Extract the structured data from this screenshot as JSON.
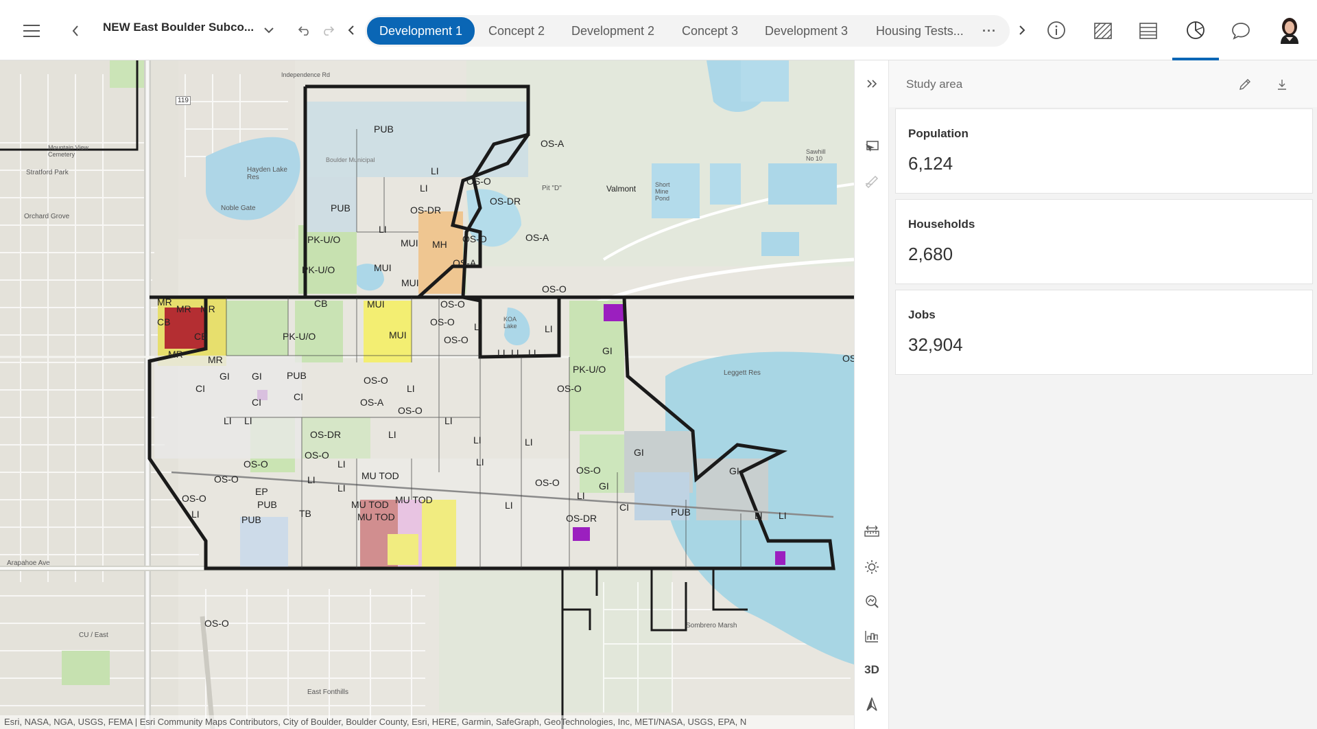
{
  "header": {
    "menu_icon": "hamburger-icon",
    "scenario_title": "NEW East Boulder Subco...",
    "tabs": [
      "Development 1",
      "Concept 2",
      "Development 2",
      "Concept 3",
      "Development 3",
      "Housing Tests..."
    ],
    "active_tab": "Development 1",
    "more_label": "···",
    "accent_color": "#0a66b5"
  },
  "map": {
    "attribution": "Esri, NASA, NGA, USGS, FEMA | Esri Community Maps Contributors, City of Boulder, Boulder County, Esri, HERE, Garmin, SafeGraph, GeoTechnologies, Inc, METI/NASA, USGS, EPA, N",
    "labels": {
      "pub_top": "PUB",
      "li_1": "LI",
      "osa_1": "OS-A",
      "oso_1": "OS-O",
      "li_2": "LI",
      "pub_2": "PUB",
      "osdr_1": "OS-DR",
      "osdr_2": "OS-DR",
      "oso_2": "OS-O",
      "osa_2": "OS-A",
      "li_3": "LI",
      "pkuo_1": "PK-U/O",
      "pkuo_2": "PK-U/O",
      "mui_1": "MUI",
      "mh": "MH",
      "mui_2": "MUI",
      "mui_3": "MUI",
      "osa_3": "OS-A",
      "oso_3": "OS-O",
      "mr_1": "MR",
      "cb_1": "CB",
      "mr_2": "MR",
      "cb_2": "CB",
      "cb_3": "CB",
      "mr_3": "MR",
      "mr_4": "MR",
      "mr_5": "MR",
      "mui_4": "MUI",
      "oso_4": "OS-O",
      "oso_5": "OS-O",
      "li_4": "LI",
      "li_5": "LI",
      "pkuo_3": "PK-U/O",
      "mui_5": "MUI",
      "oso_6": "OS-O",
      "li_6": "LI",
      "li_7": "LI",
      "li_8": "LI",
      "gi_1": "GI",
      "pkuo_4": "PK-U/O",
      "ci_1": "CI",
      "gi_2": "GI",
      "gi_3": "GI",
      "pub_3": "PUB",
      "ci_2": "CI",
      "ci_3": "CI",
      "oso_7": "OS-O",
      "osa_4": "OS-A",
      "li_9": "LI",
      "oso_8": "OS-O",
      "oso_9": "OS-O",
      "li_10": "LI",
      "li_11": "LI",
      "li_12": "LI",
      "osdr_3": "OS-DR",
      "li_13": "LI",
      "oso_10": "OS-O",
      "oso_11": "OS-O",
      "li_14": "LI",
      "li_15": "LI",
      "li_16": "LI",
      "gi_4": "GI",
      "gi_5": "GI",
      "oso_12": "OS-O",
      "oso_13": "OS-O",
      "oso_14": "OS-O",
      "li_17": "LI",
      "mutod_1": "MU TOD",
      "mutod_2": "MU TOD",
      "mutod_3": "MU TOD",
      "mutod_4": "MU TOD",
      "ep": "EP",
      "pub_4": "PUB",
      "pub_5": "PUB",
      "tb": "TB",
      "li_18": "LI",
      "li_19": "LI",
      "li_20": "LI",
      "oso_15": "OS-O",
      "oso_16": "OS-O",
      "li_21": "LI",
      "gi_6": "GI",
      "li_22": "LI",
      "osdr_4": "OS-DR",
      "ci_4": "CI",
      "pub_6": "PUB",
      "li_23": "LI",
      "li_24": "LI",
      "oso_17": "OS-O",
      "os_edge": "OS",
      "place_valmont": "Valmont",
      "place_hayden": "Hayden Lake Res",
      "place_leggett": "Leggett Res",
      "place_mountain": "Mountain View Cemetery",
      "place_stratford": "Stratford Park",
      "place_orchard": "Orchard Grove",
      "place_noble": "Noble Gate",
      "place_cu_east": "CU / East",
      "place_east_fonthills": "East Fonthills",
      "place_sombrero": "Sombrero Marsh",
      "place_arapahoe": "Arapahoe Ave",
      "place_independence": "Independence Rd",
      "place_boulder_mun": "Boulder Municipal",
      "place_koa": "KOA Lake",
      "place_pit_d": "Pit \"D\"",
      "place_short_mine": "Short Mine Pond",
      "place_sombrero2": "Sawhill No 10",
      "place_hwy119": "119"
    }
  },
  "toolbar": {
    "tools": [
      "collapse-panel-icon",
      "select-features-icon",
      "sketch-icon",
      "measure-icon",
      "daylight-icon",
      "slice-icon",
      "elevation-profile-icon",
      "3d-toggle",
      "north-arrow-icon"
    ],
    "label_3d": "3D"
  },
  "panel": {
    "title": "Study area",
    "cards": [
      {
        "label": "Population",
        "value": "6,124"
      },
      {
        "label": "Households",
        "value": "2,680"
      },
      {
        "label": "Jobs",
        "value": "32,904"
      }
    ]
  }
}
